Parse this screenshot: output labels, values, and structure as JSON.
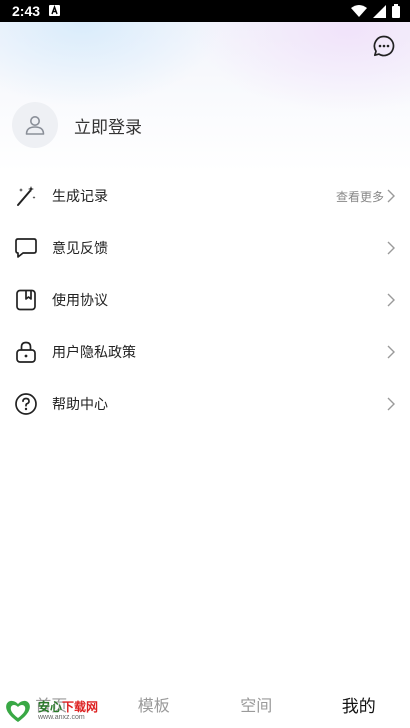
{
  "status_bar": {
    "time": "2:43"
  },
  "profile": {
    "login_label": "立即登录"
  },
  "menu": [
    {
      "label": "生成记录",
      "extra": "查看更多",
      "icon": "magic-wand-icon"
    },
    {
      "label": "意见反馈",
      "extra": "",
      "icon": "chat-bubble-icon"
    },
    {
      "label": "使用协议",
      "extra": "",
      "icon": "bookmark-document-icon"
    },
    {
      "label": "用户隐私政策",
      "extra": "",
      "icon": "lock-icon"
    },
    {
      "label": "帮助中心",
      "extra": "",
      "icon": "question-circle-icon"
    }
  ],
  "tabbar": {
    "tabs": [
      {
        "label": "首页"
      },
      {
        "label": "模板"
      },
      {
        "label": "空间"
      },
      {
        "label": "我的"
      }
    ],
    "active": "我的"
  },
  "watermark": {
    "name_part1": "安心",
    "name_part2": "下载网",
    "url": "www.anxz.com"
  },
  "colors": {
    "accent_text": "#111111",
    "inactive_tab": "#9a9a9a",
    "chevron": "#9a9a9a"
  }
}
